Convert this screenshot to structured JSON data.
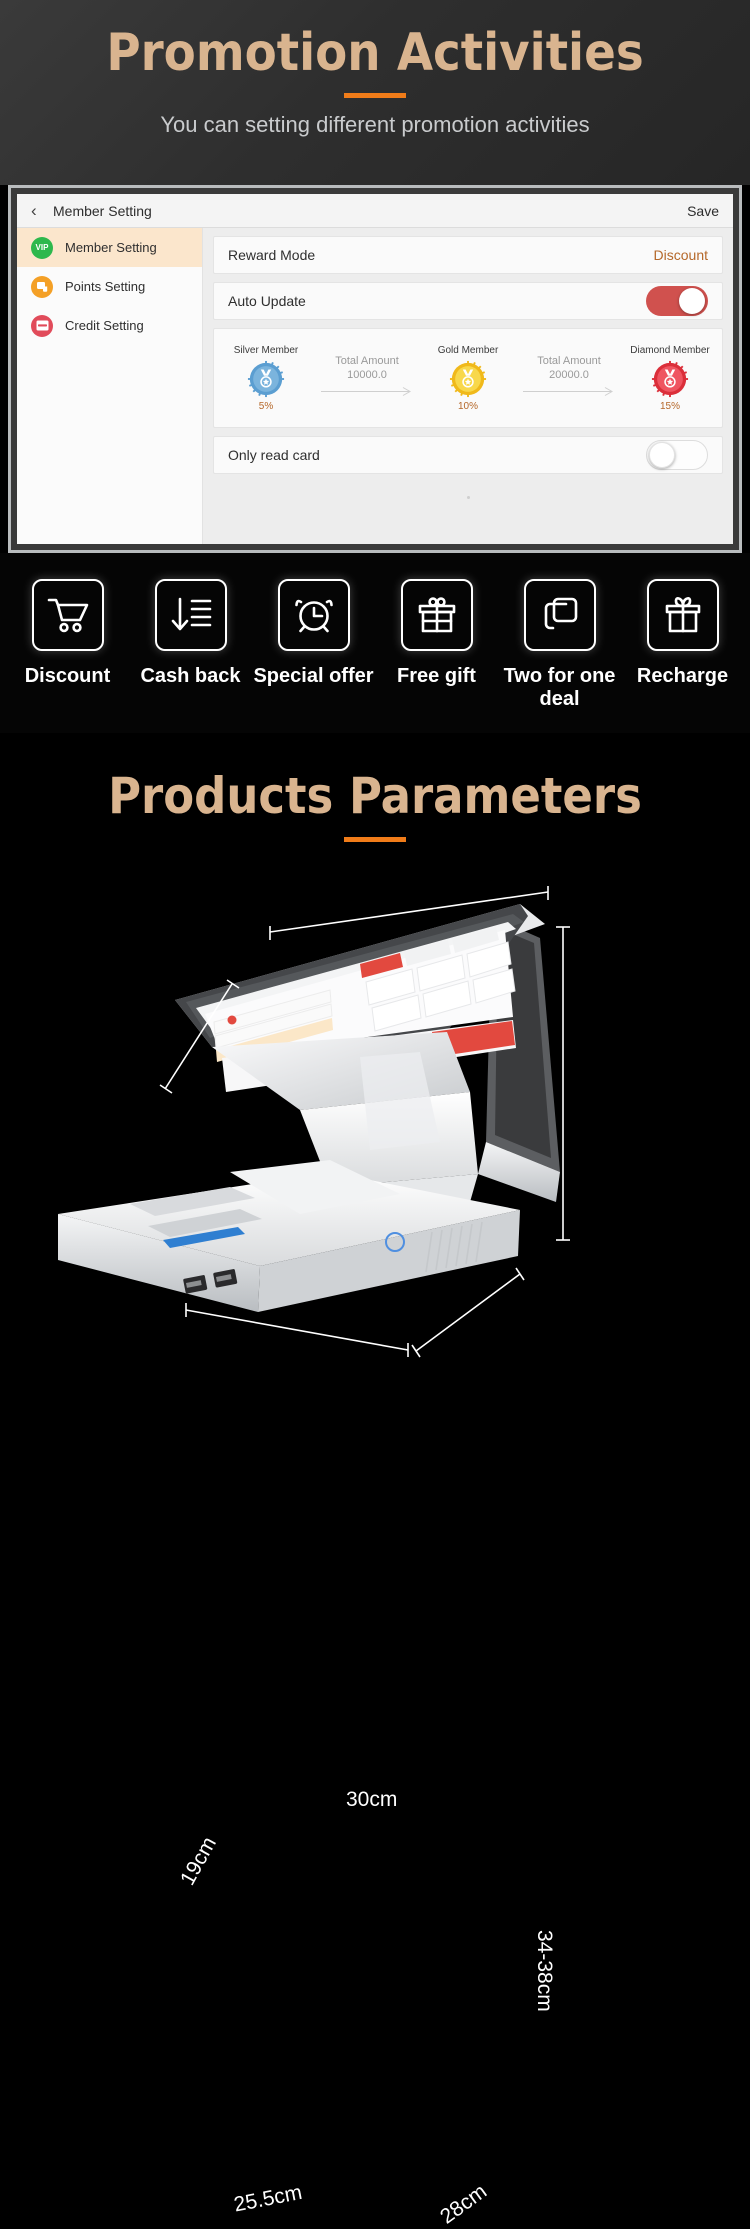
{
  "promo": {
    "title": "Promotion Activities",
    "subtitle": "You can setting different promotion activities",
    "accent_color": "#f07c19",
    "title_color": "#d9b48f"
  },
  "device_ui": {
    "topbar": {
      "back_icon": "chevron-left-icon",
      "title": "Member Setting",
      "save_label": "Save"
    },
    "sidebar": [
      {
        "label": "Member Setting",
        "icon": "vip-badge-icon",
        "active": true
      },
      {
        "label": "Points Setting",
        "icon": "points-card-icon",
        "active": false
      },
      {
        "label": "Credit Setting",
        "icon": "credit-card-icon",
        "active": false
      }
    ],
    "rows": [
      {
        "label": "Reward Mode",
        "value": "Discount",
        "type": "value"
      },
      {
        "label": "Auto Update",
        "toggle": "on",
        "type": "toggle"
      }
    ],
    "tiers": [
      {
        "name": "Silver Member",
        "percent": "5%",
        "color": "#5b9ed1"
      },
      {
        "name": "Gold Member",
        "percent": "10%",
        "color": "#f5cd2c"
      },
      {
        "name": "Diamond Member",
        "percent": "15%",
        "color": "#e8434c"
      }
    ],
    "connectors": [
      {
        "label": "Total Amount",
        "value": "10000.0"
      },
      {
        "label": "Total Amount",
        "value": "20000.0"
      }
    ],
    "bottom_row": {
      "label": "Only read card",
      "toggle": "off"
    }
  },
  "features": [
    {
      "label": "Discount",
      "icon": "shopping-cart-icon"
    },
    {
      "label": "Cash back",
      "icon": "sort-descending-list-icon"
    },
    {
      "label": "Special offer",
      "icon": "alarm-clock-icon"
    },
    {
      "label": "Free gift",
      "icon": "gift-box-icon"
    },
    {
      "label": "Two for one deal",
      "icon": "copy-squares-icon"
    },
    {
      "label": "Recharge",
      "icon": "gift-bow-icon"
    }
  ],
  "params": {
    "title": "Products Parameters"
  },
  "dimensions": {
    "screen_width": "30cm",
    "screen_depth": "19cm",
    "total_height": "34-38cm",
    "base_width": "25.5cm",
    "base_depth": "28cm"
  }
}
